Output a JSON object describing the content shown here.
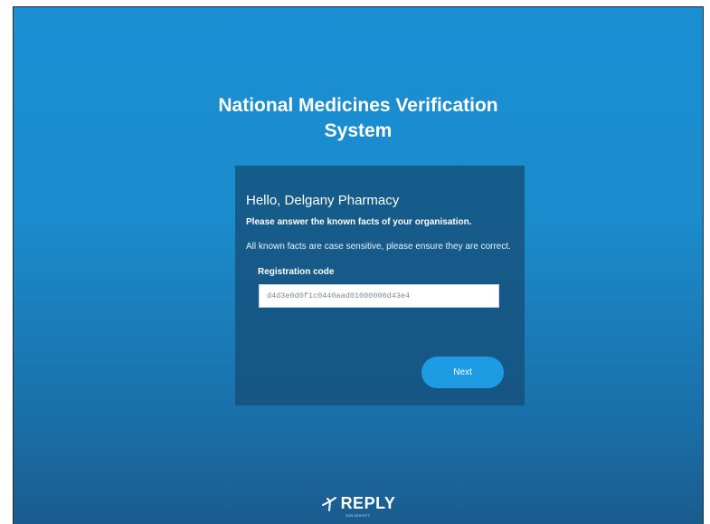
{
  "page": {
    "title_line1": "National Medicines Verification",
    "title_line2": "System"
  },
  "card": {
    "greeting": "Hello, Delgany Pharmacy",
    "instruction": "Please answer the known facts of your organisation.",
    "case_note": "All known facts are case sensitive, please ensure they are correct.",
    "field_label": "Registration code",
    "field_value": "d4d3e0d0f1c0440aad01000000d43e4",
    "next_label": "Next"
  },
  "footer": {
    "brand": "REPLY",
    "brand_sub": "SOLIDSOFT",
    "logo_icon": "reply-logo-icon"
  },
  "colors": {
    "background_top": "#1a8fd3",
    "background_bottom": "#1a5c8e",
    "card": "#144e78",
    "button": "#1d9be3"
  }
}
